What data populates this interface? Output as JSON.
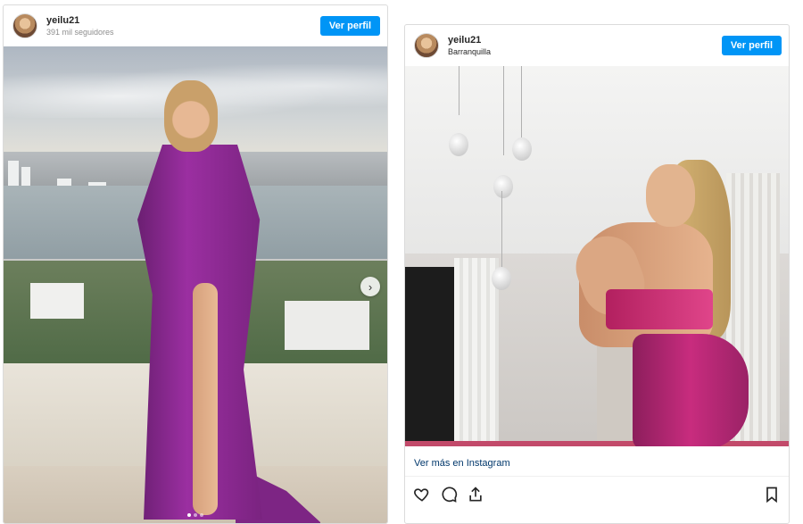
{
  "posts": [
    {
      "username": "yeilu21",
      "subline": "391 mil seguidores",
      "profile_button": "Ver perfil",
      "carousel_icon": "chevron-right-icon",
      "carousel_dots": 3
    },
    {
      "username": "yeilu21",
      "subline": "Barranquilla",
      "profile_button": "Ver perfil",
      "more_link": "Ver más en Instagram",
      "action_icons": [
        "heart-icon",
        "comment-icon",
        "share-icon",
        "bookmark-icon"
      ]
    }
  ],
  "colors": {
    "button_blue": "#0095f6",
    "link_blue": "#00376b",
    "border": "#dbdbdb"
  }
}
